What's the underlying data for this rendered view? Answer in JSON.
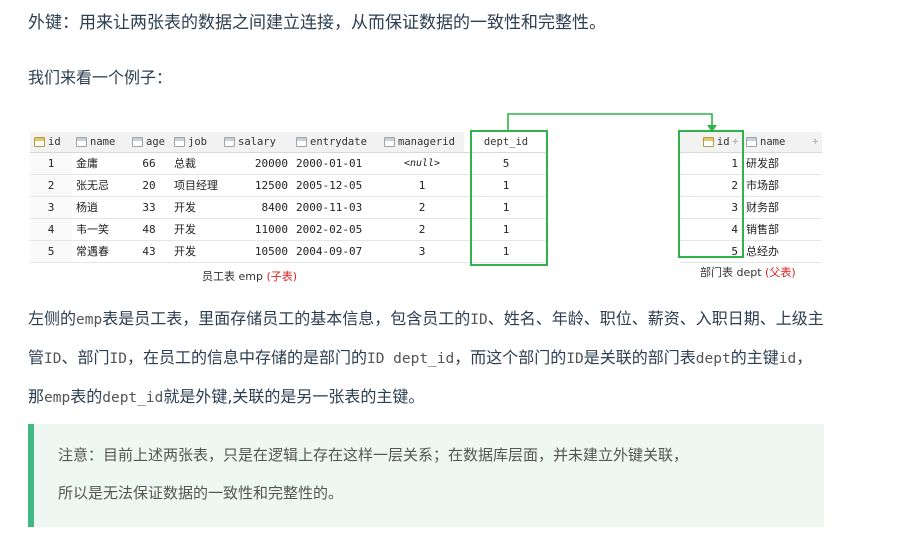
{
  "heading": "外键：用来让两张表的数据之间建立连接，从而保证数据的一致性和完整性。",
  "sub_heading": "我们来看一个例子：",
  "emp_table": {
    "headers": [
      "id",
      "name",
      "age",
      "job",
      "salary",
      "entrydate",
      "managerid",
      "dept_id"
    ],
    "rows": [
      {
        "rowno": "1",
        "name": "金庸",
        "age": "66",
        "job": "总裁",
        "salary": "20000",
        "entrydate": "2000-01-01",
        "managerid": "<null>",
        "dept_id": "5"
      },
      {
        "rowno": "2",
        "name": "张无忌",
        "age": "20",
        "job": "项目经理",
        "salary": "12500",
        "entrydate": "2005-12-05",
        "managerid": "1",
        "dept_id": "1"
      },
      {
        "rowno": "3",
        "name": "杨逍",
        "age": "33",
        "job": "开发",
        "salary": "8400",
        "entrydate": "2000-11-03",
        "managerid": "2",
        "dept_id": "1"
      },
      {
        "rowno": "4",
        "name": "韦一笑",
        "age": "48",
        "job": "开发",
        "salary": "11000",
        "entrydate": "2002-02-05",
        "managerid": "2",
        "dept_id": "1"
      },
      {
        "rowno": "5",
        "name": "常遇春",
        "age": "43",
        "job": "开发",
        "salary": "10500",
        "entrydate": "2004-09-07",
        "managerid": "3",
        "dept_id": "1"
      }
    ],
    "caption_main": "员工表 emp ",
    "caption_role": "(子表)"
  },
  "dept_table": {
    "headers": [
      "id",
      "name"
    ],
    "sort_glyph": "÷",
    "rows": [
      {
        "id": "1",
        "name": "研发部"
      },
      {
        "id": "2",
        "name": "市场部"
      },
      {
        "id": "3",
        "name": "财务部"
      },
      {
        "id": "4",
        "name": "销售部"
      },
      {
        "id": "5",
        "name": "总经办"
      }
    ],
    "caption_main": "部门表 dept ",
    "caption_role": "(父表)"
  },
  "paragraph": {
    "p1": "左侧的",
    "c1": "emp",
    "p2": "表是员工表，里面存储员工的基本信息，包含员工的",
    "c2": "ID",
    "p3": "、姓名、年龄、职位、薪资、入职日期、上级主管",
    "c3": "ID",
    "p4": "、部门",
    "c4": "ID",
    "p5": "，在员工的信息中存储的是部门的",
    "c5": "ID dept_id",
    "p6": "，而这个部门的",
    "c6": "ID",
    "p7": "是关联的部门表",
    "c7": "dept",
    "p8": "的主键",
    "c8": "id",
    "p9": "，那",
    "c9": "emp",
    "p10": "表的",
    "c10": "dept_id",
    "p11": "就是外键,关联的是另一张表的主键。"
  },
  "note": {
    "line1": "注意：目前上述两张表，只是在逻辑上存在这样一层关系；在数据库层面，并未建立外键关联，",
    "line2": "所以是无法保证数据的一致性和完整性的。"
  },
  "colors": {
    "green": "#2fb34a",
    "red": "#e02020",
    "accent": "#42b983"
  }
}
